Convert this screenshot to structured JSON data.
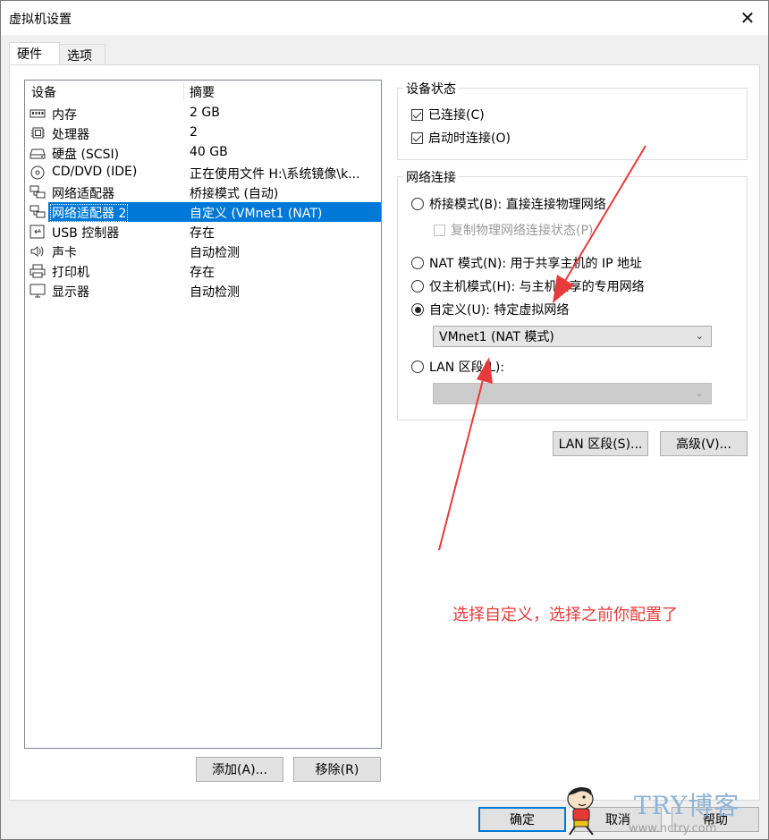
{
  "window": {
    "title": "虚拟机设置",
    "close_glyph": "✕"
  },
  "tabs": [
    {
      "label": "硬件",
      "active": true
    },
    {
      "label": "选项",
      "active": false
    }
  ],
  "device_list": {
    "header": {
      "device": "设备",
      "summary": "摘要"
    },
    "rows": [
      {
        "icon": "memory-icon",
        "name": "内存",
        "summary": "2 GB"
      },
      {
        "icon": "processor-icon",
        "name": "处理器",
        "summary": "2"
      },
      {
        "icon": "hard-disk-icon",
        "name": "硬盘 (SCSI)",
        "summary": "40 GB"
      },
      {
        "icon": "cd-dvd-icon",
        "name": "CD/DVD (IDE)",
        "summary": "正在使用文件 H:\\系统镜像\\k..."
      },
      {
        "icon": "network-adapter-icon",
        "name": "网络适配器",
        "summary": "桥接模式 (自动)"
      },
      {
        "icon": "network-adapter-icon",
        "name": "网络适配器 2",
        "summary": "自定义 (VMnet1 (NAT)",
        "selected": true
      },
      {
        "icon": "usb-icon",
        "name": "USB 控制器",
        "summary": "存在"
      },
      {
        "icon": "sound-card-icon",
        "name": "声卡",
        "summary": "自动检测"
      },
      {
        "icon": "printer-icon",
        "name": "打印机",
        "summary": "存在"
      },
      {
        "icon": "display-icon",
        "name": "显示器",
        "summary": "自动检测"
      }
    ]
  },
  "list_buttons": {
    "add": "添加(A)...",
    "remove": "移除(R)"
  },
  "device_status": {
    "title": "设备状态",
    "connected": {
      "label": "已连接(C)",
      "checked": true
    },
    "connect_at_power_on": {
      "label": "启动时连接(O)",
      "checked": true
    }
  },
  "network": {
    "title": "网络连接",
    "bridged": {
      "label": "桥接模式(B): 直接连接物理网络",
      "checked": false
    },
    "replicate": {
      "label": "复制物理网络连接状态(P)",
      "checked": false,
      "disabled": true
    },
    "nat": {
      "label": "NAT 模式(N): 用于共享主机的 IP 地址",
      "checked": false
    },
    "host_only": {
      "label": "仅主机模式(H): 与主机共享的专用网络",
      "checked": false
    },
    "custom": {
      "label": "自定义(U): 特定虚拟网络",
      "checked": true
    },
    "custom_select": "VMnet1 (NAT 模式)",
    "lan_segment": {
      "label": "LAN 区段(L):",
      "checked": false
    },
    "lan_select": ""
  },
  "net_buttons": {
    "lan_segments": "LAN 区段(S)...",
    "advanced": "高级(V)..."
  },
  "annotation": {
    "text": "选择自定义，选择之前你配置了",
    "color": "#e83a3a"
  },
  "footer": {
    "ok": "确定",
    "cancel": "取消",
    "help": "帮助"
  },
  "watermark": {
    "brand": "TRY博客",
    "url": "www.nctry.com"
  },
  "colors": {
    "selection": "#0078d7",
    "annotation": "#e83a3a",
    "accent": "#0078d7"
  }
}
